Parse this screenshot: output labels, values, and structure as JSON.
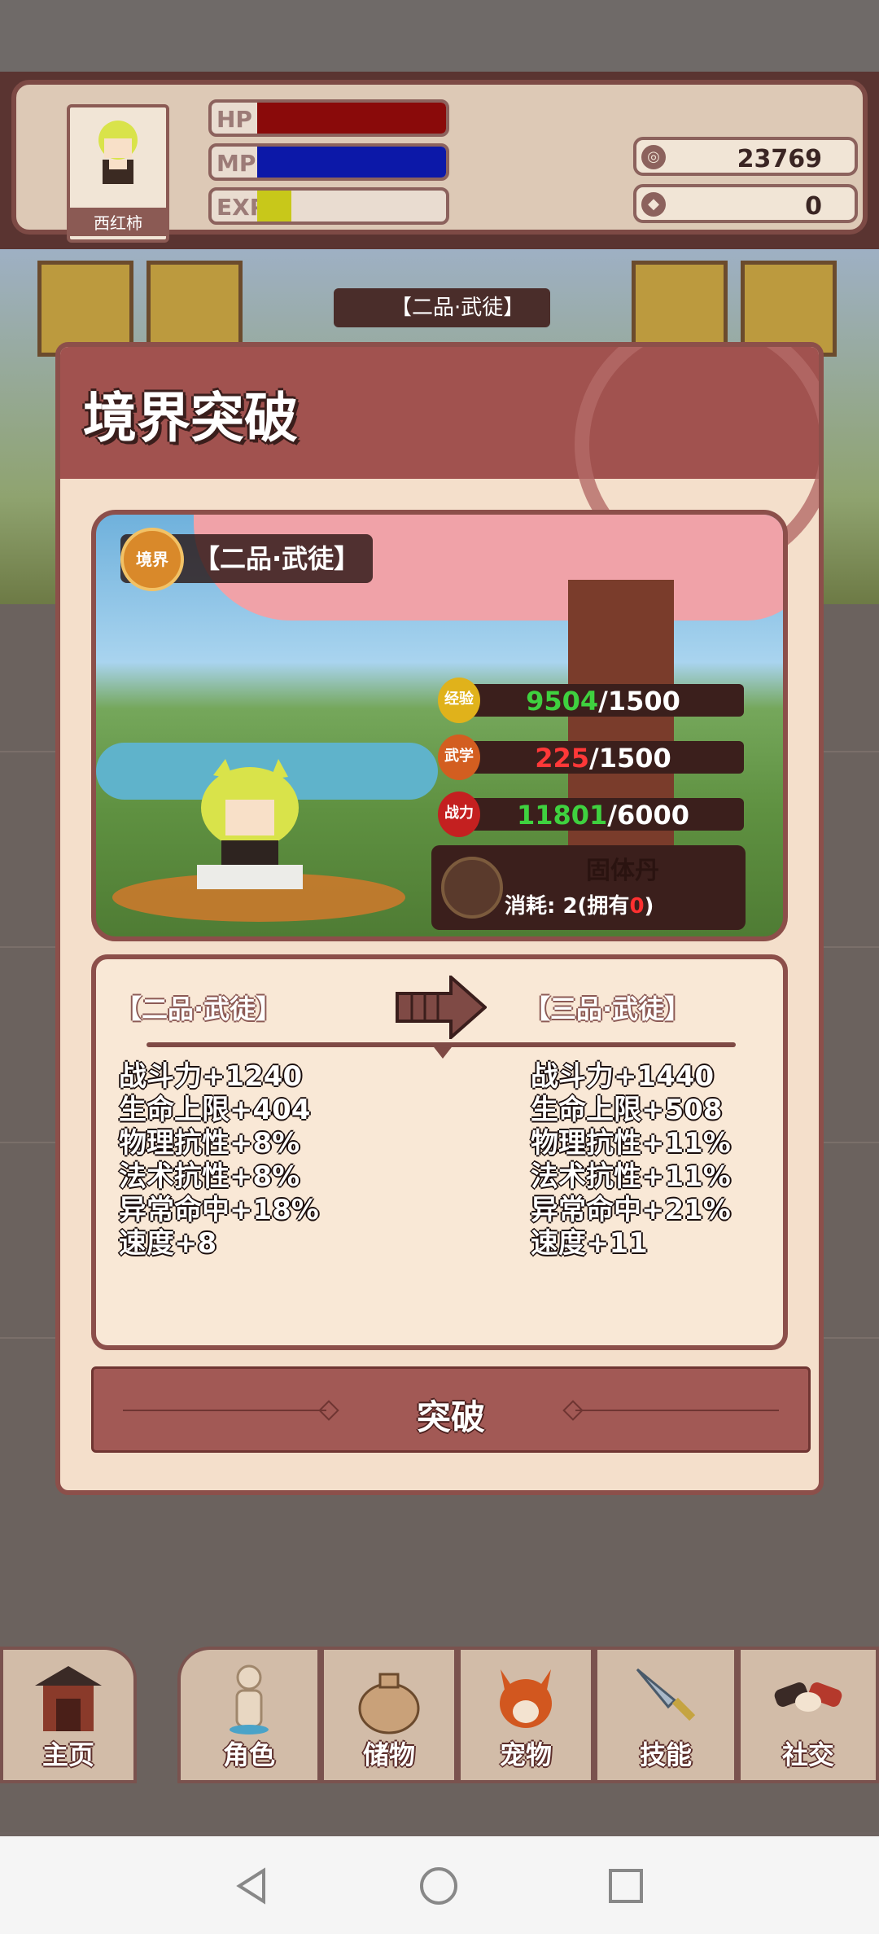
{
  "player": {
    "name": "西红柿",
    "hp_label": "HP",
    "mp_label": "MP",
    "exp_label": "EXP",
    "hp_fraction": 1.0,
    "mp_fraction": 1.0,
    "exp_fraction": 0.18,
    "coins": "23769",
    "gems": "0"
  },
  "scene": {
    "rank_label": "【二品·武徒】"
  },
  "modal": {
    "title": "境界突破",
    "badge_icon_text": "境界",
    "current_rank": "【二品·武徒】",
    "requirements": [
      {
        "icon_text": "经验",
        "current": "9504",
        "required": "/1500",
        "current_color": "green",
        "medal_color": "#e0b21b"
      },
      {
        "icon_text": "武学",
        "current": "225",
        "required": "/1500",
        "current_color": "red",
        "medal_color": "#d35e20"
      },
      {
        "icon_text": "战力",
        "current": "11801",
        "required": "/6000",
        "current_color": "green",
        "medal_color": "#c42020"
      }
    ],
    "item": {
      "name": "固体丹",
      "cost_prefix": "消耗: 2(拥有",
      "owned": "0",
      "cost_suffix": ")"
    },
    "compare": {
      "from_rank": "【二品·武徒】",
      "to_rank": "【三品·武徒】",
      "from_stats": [
        "战斗力+1240",
        "生命上限+404",
        "物理抗性+8%",
        "法术抗性+8%",
        "异常命中+18%",
        "速度+8"
      ],
      "to_stats": [
        "战斗力+1440",
        "生命上限+508",
        "物理抗性+11%",
        "法术抗性+11%",
        "异常命中+21%",
        "速度+11"
      ]
    },
    "button_label": "突破"
  },
  "nav": {
    "items": [
      {
        "label": "主页",
        "icon": "gate-icon"
      },
      {
        "label": "角色",
        "icon": "character-icon"
      },
      {
        "label": "储物",
        "icon": "bag-icon"
      },
      {
        "label": "宠物",
        "icon": "fox-icon"
      },
      {
        "label": "技能",
        "icon": "sword-icon"
      },
      {
        "label": "社交",
        "icon": "handshake-icon"
      }
    ]
  },
  "colors": {
    "hp": "#8a0a0a",
    "mp": "#0c18a8",
    "exp": "#c8c81a",
    "modal_header": "#a1524f",
    "modal_border": "#8c4f4a",
    "button": "#a25955"
  }
}
